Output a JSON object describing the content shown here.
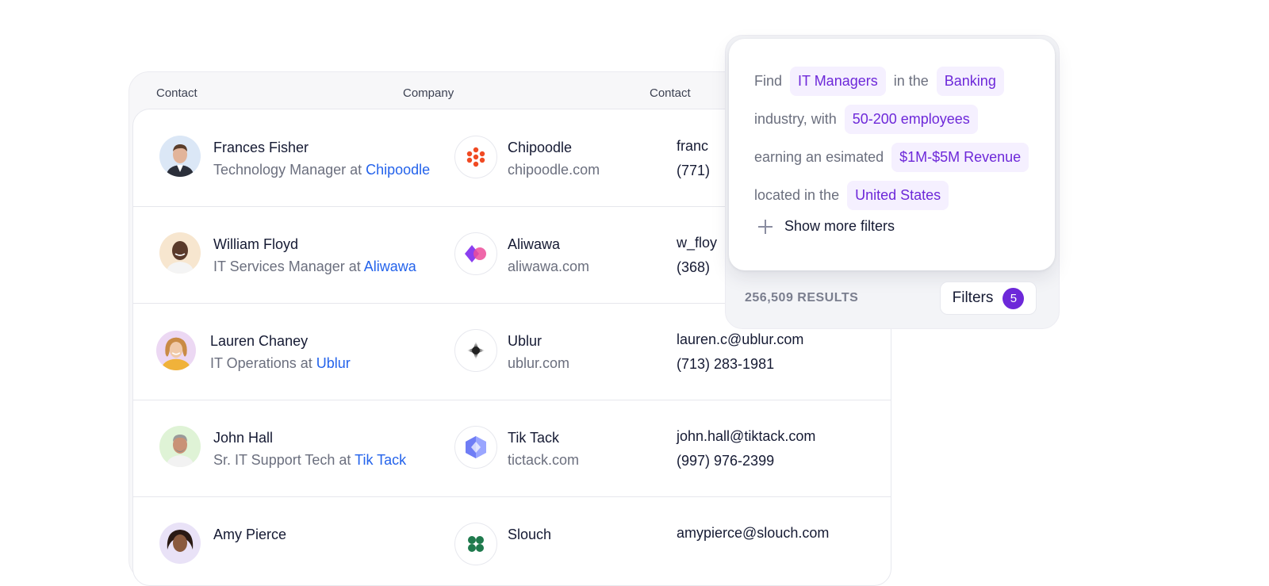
{
  "table": {
    "headers": [
      "Contact",
      "Company",
      "Contact"
    ],
    "rows": [
      {
        "name": "Frances Fisher",
        "role": "Technology Manager at ",
        "company": "Chipoodle",
        "domain": "chipoodle.com",
        "email": "franc",
        "phone": "(771)"
      },
      {
        "name": "William Floyd",
        "role": "IT Services Manager at ",
        "company": "Aliwawa",
        "domain": "aliwawa.com",
        "email": "w_floy",
        "phone": "(368)"
      },
      {
        "name": "Lauren Chaney",
        "role": "IT Operations at ",
        "company": "Ublur",
        "domain": "ublur.com",
        "email": "lauren.c@ublur.com",
        "phone": "(713) 283-1981"
      },
      {
        "name": "John Hall",
        "role": "Sr. IT Support Tech at ",
        "company": "Tik Tack",
        "domain": "tictack.com",
        "email": "john.hall@tiktack.com",
        "phone": "(997) 976-2399"
      },
      {
        "name": "Amy Pierce",
        "role": "",
        "company": "Slouch",
        "domain": "",
        "email": "amypierce@slouch.com",
        "phone": ""
      }
    ]
  },
  "filter": {
    "rows": [
      {
        "prefix": "Find",
        "chip": "IT Managers",
        "suffix": "in the",
        "chip2": "Banking"
      },
      {
        "prefix": "industry, with",
        "chip": "50-200 employees"
      },
      {
        "prefix": "earning an esimated",
        "chip": "$1M-$5M Revenue"
      },
      {
        "prefix": "located in the",
        "chip": "United States"
      }
    ],
    "show_more": "Show more filters",
    "results": "256,509 RESULTS",
    "filters_label": "Filters",
    "filters_count": "5"
  },
  "colors": {
    "accent": "#6d28d9",
    "chip_bg": "#f5f0ff",
    "link": "#2463eb"
  }
}
